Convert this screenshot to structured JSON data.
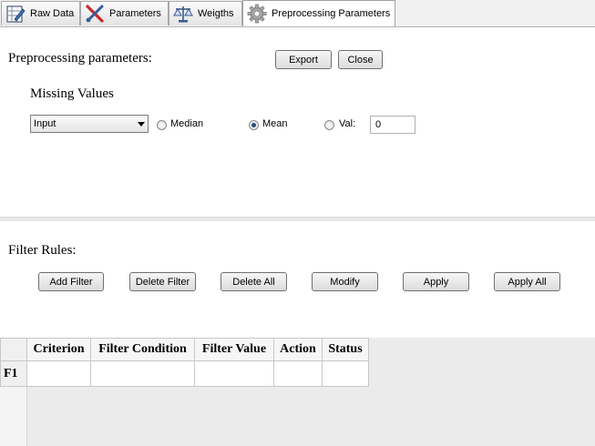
{
  "tabs": [
    {
      "label": "Raw Data",
      "icon": "raw-data-icon"
    },
    {
      "label": "Parameters",
      "icon": "parameters-icon"
    },
    {
      "label": "Weigths",
      "icon": "scales-icon"
    },
    {
      "label": "Preprocessing Parameters",
      "icon": "gear-icon",
      "active": true
    }
  ],
  "header": {
    "title": "Preprocessing parameters:",
    "export_label": "Export",
    "close_label": "Close"
  },
  "missing_values": {
    "title": "Missing Values",
    "select_value": "Input",
    "options": {
      "median": "Median",
      "mean": "Mean",
      "val": "Val:"
    },
    "selected": "Mean",
    "val_value": "0"
  },
  "filter": {
    "title": "Filter Rules:",
    "buttons": {
      "add": "Add Filter",
      "delete": "Delete Filter",
      "delete_all": "Delete All",
      "modify": "Modify",
      "apply": "Apply",
      "apply_all": "Apply All"
    }
  },
  "table": {
    "columns": [
      "Criterion",
      "Filter Condition",
      "Filter Value",
      "Action",
      "Status"
    ],
    "rows": [
      {
        "header": "F1",
        "cells": [
          "",
          "",
          "",
          "",
          ""
        ]
      }
    ]
  }
}
